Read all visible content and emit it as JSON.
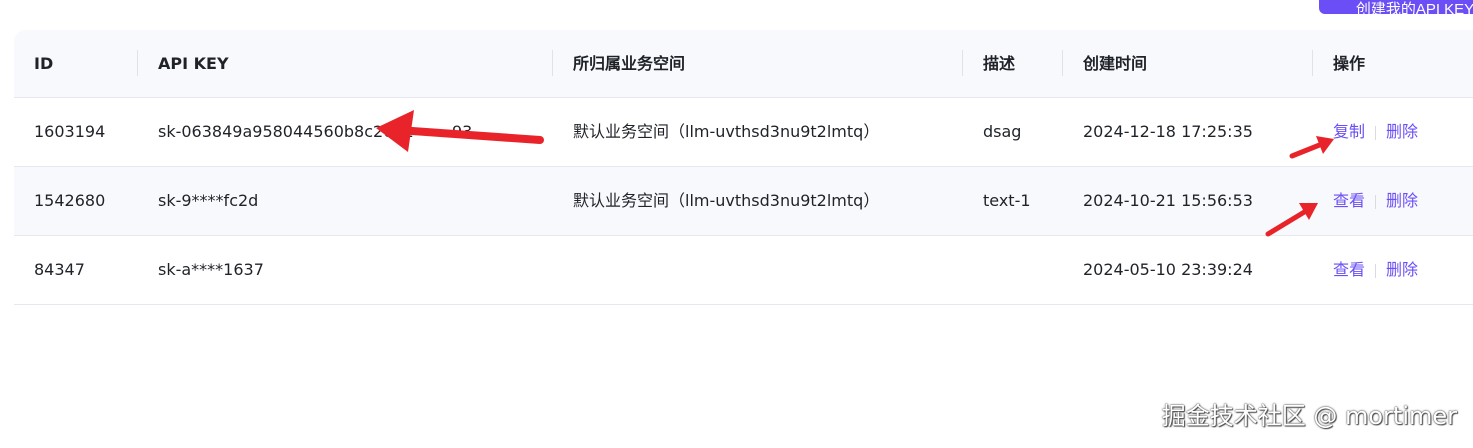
{
  "header_action": {
    "label": "创建我的API KEY"
  },
  "table": {
    "columns": {
      "id": "ID",
      "api_key": "API KEY",
      "workspace": "所归属业务空间",
      "description": "描述",
      "created_at": "创建时间",
      "actions": "操作"
    },
    "rows": [
      {
        "id": "1603194",
        "api_key": "sk-063849a958044560b8c2021",
        "api_key_tail": "93",
        "workspace": "默认业务空间（llm-uvthsd3nu9t2lmtq）",
        "description": "dsag",
        "created_at": "2024-12-18 17:25:35",
        "action_primary": "复制",
        "action_delete": "删除"
      },
      {
        "id": "1542680",
        "api_key": "sk-9****fc2d",
        "workspace": "默认业务空间（llm-uvthsd3nu9t2lmtq）",
        "description": "text-1",
        "created_at": "2024-10-21 15:56:53",
        "action_primary": "查看",
        "action_delete": "删除"
      },
      {
        "id": "84347",
        "api_key": "sk-a****1637",
        "workspace": "",
        "description": "",
        "created_at": "2024-05-10 23:39:24",
        "action_primary": "查看",
        "action_delete": "删除"
      }
    ]
  },
  "colors": {
    "accent": "#6b4ef5",
    "annotation_arrow": "#e8242a",
    "header_bg": "#f8f9fc"
  },
  "watermark": "掘金技术社区 @ mortimer"
}
